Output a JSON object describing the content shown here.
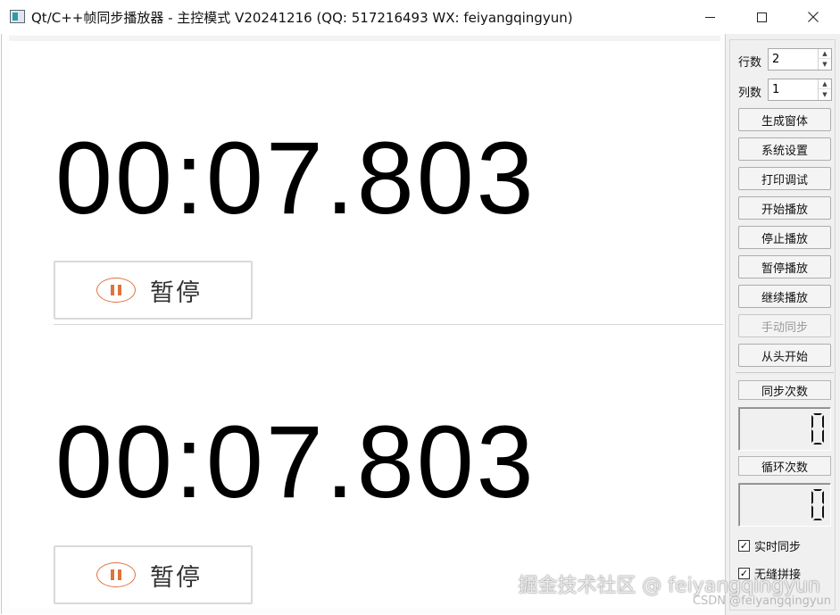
{
  "window": {
    "title": "Qt/C++帧同步播放器 - 主控模式  V20241216 (QQ: 517216493 WX: feiyangqingyun)",
    "controls": {
      "minimize": "—",
      "maximize": "☐",
      "close": "✕"
    }
  },
  "players": [
    {
      "time": "00:07.803",
      "pause_label": "暂停"
    },
    {
      "time": "00:07.803",
      "pause_label": "暂停"
    }
  ],
  "panel": {
    "rows": {
      "label": "行数",
      "value": "2"
    },
    "cols": {
      "label": "列数",
      "value": "1"
    },
    "buttons": [
      {
        "label": "生成窗体",
        "enabled": true
      },
      {
        "label": "系统设置",
        "enabled": true
      },
      {
        "label": "打印调试",
        "enabled": true
      },
      {
        "label": "开始播放",
        "enabled": true
      },
      {
        "label": "停止播放",
        "enabled": true
      },
      {
        "label": "暂停播放",
        "enabled": true
      },
      {
        "label": "继续播放",
        "enabled": true
      },
      {
        "label": "手动同步",
        "enabled": false
      },
      {
        "label": "从头开始",
        "enabled": true
      }
    ],
    "sync_count": {
      "label": "同步次数",
      "value": "0"
    },
    "loop_count": {
      "label": "循环次数",
      "value": "0"
    },
    "checkboxes": [
      {
        "label": "实时同步",
        "checked": true
      },
      {
        "label": "无缝拼接",
        "checked": true
      }
    ]
  },
  "watermark": {
    "main": "掘金技术社区 @ feiyangqingyun",
    "sub": "CSDN @feiyangqingyun"
  },
  "colors": {
    "accent": "#e0723c",
    "panel_bg": "#f0f0f0"
  }
}
